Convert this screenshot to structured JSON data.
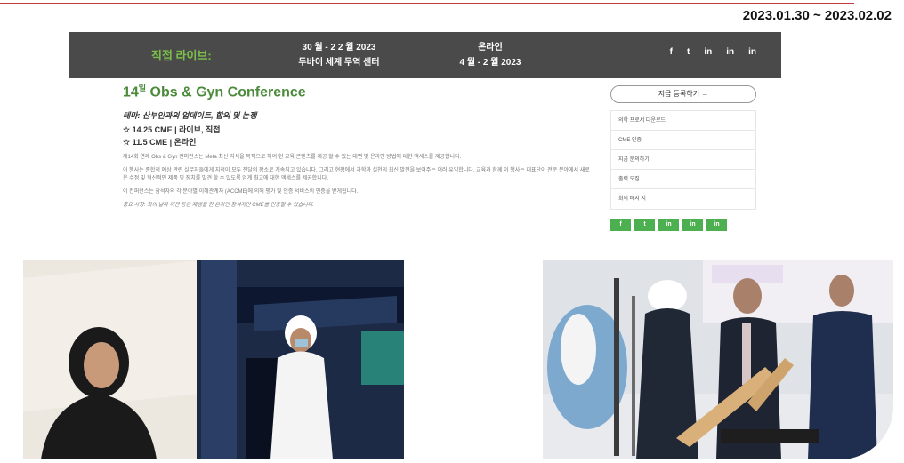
{
  "date_range": "2023.01.30 ~ 2023.02.02",
  "banner": {
    "live_label": "직접 라이브:",
    "live_dates": "30 월 - 2 2 월 2023",
    "live_venue": "두바이 세계 무역 센터",
    "online_label": "온라인",
    "online_dates": "4 월 - 2 월 2023",
    "social": [
      "f",
      "t",
      "in",
      "in",
      "in"
    ]
  },
  "main": {
    "title": "14",
    "title_sup": "일",
    "title_rest": " Obs & Gyn Conference",
    "subtitle": "테마: 산부인과의 업데이트, 합의 및 논쟁",
    "cme1": "☆ 14.25 CME | 라이브, 직접",
    "cme2": "☆ 11.5 CME | 온라인",
    "paragraphs": [
      "제14회 연례 Obs & Gyn 컨퍼런스는 Meta 최신 지식을 목적으로 하여 현 교육 콘텐츠를 제공 할 수 있는 대면 및 온라인 방법에 대한 액세스를 제공합니다.",
      "이 행사는 종합적 예상 관련 실무자들에게 지적이 모두 전달의 장소로 계속되고 있습니다. 그리고 현장에서 과학과 실천의 최신 발전을 보여주는 여러 유익합니다. 교육과 함께 이 행사는 대표단이 전문 분야에서 새로운 수정 및 혁신적인 제품 및 장치를 발견 할 수 있도록 업계 최고에 대한 액세스를 제공합니다.",
      "이 컨퍼런스는 참석자의 각 분야별 이해관계자 (ACCME)에 의해 평가 및 인증 서비스의 인증을 받게됩니다.",
      "중요 사항: 회의 날짜 이전 등은 재생을 한 온라인 참석자만 CME를 인증할 수 있습니다."
    ]
  },
  "side": {
    "register_btn": "지금 등록하기 →",
    "links": [
      "의학 프로서 다운로드",
      "CME 인증",
      "지금 문의하기",
      "출력 모집",
      "회의 배지 지"
    ],
    "social": [
      "f",
      "t",
      "in",
      "in",
      "in"
    ]
  }
}
